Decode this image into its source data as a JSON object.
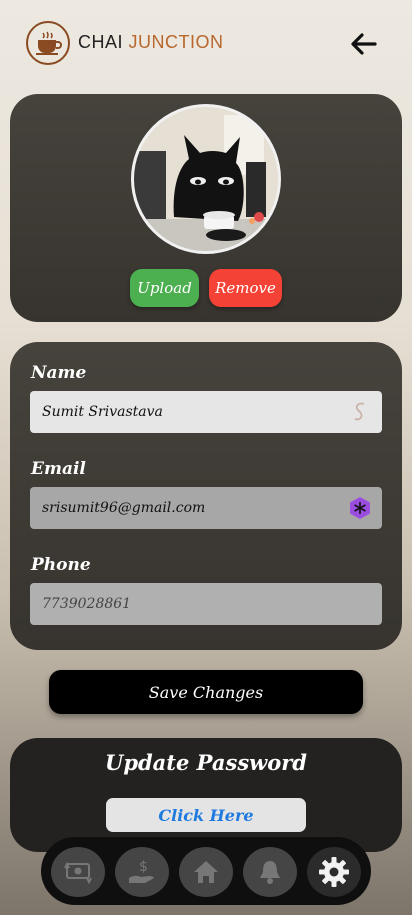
{
  "header": {
    "brand_prefix": "CHAI",
    "brand_suffix": "JUNCTION",
    "back_icon": "arrow-left-icon",
    "logo_icon": "tea-cup-icon"
  },
  "photo_card": {
    "upload_label": "Upload",
    "remove_label": "Remove"
  },
  "form": {
    "name_label": "Name",
    "name_value": "Sumit Srivastava",
    "email_label": "Email",
    "email_value": "srisumit96@gmail.com",
    "phone_label": "Phone",
    "phone_value": "7739028861"
  },
  "save_label": "Save Changes",
  "password_card": {
    "title": "Update Password",
    "button_label": "Click Here"
  },
  "nav": {
    "items": [
      {
        "icon": "money-exchange-icon"
      },
      {
        "icon": "hand-dollar-icon"
      },
      {
        "icon": "home-icon"
      },
      {
        "icon": "bell-icon"
      },
      {
        "icon": "gear-icon",
        "active": true
      }
    ]
  },
  "colors": {
    "upload": "#4caf50",
    "remove": "#f44336",
    "link": "#1f7ae0",
    "brand_accent": "#b8672e"
  }
}
